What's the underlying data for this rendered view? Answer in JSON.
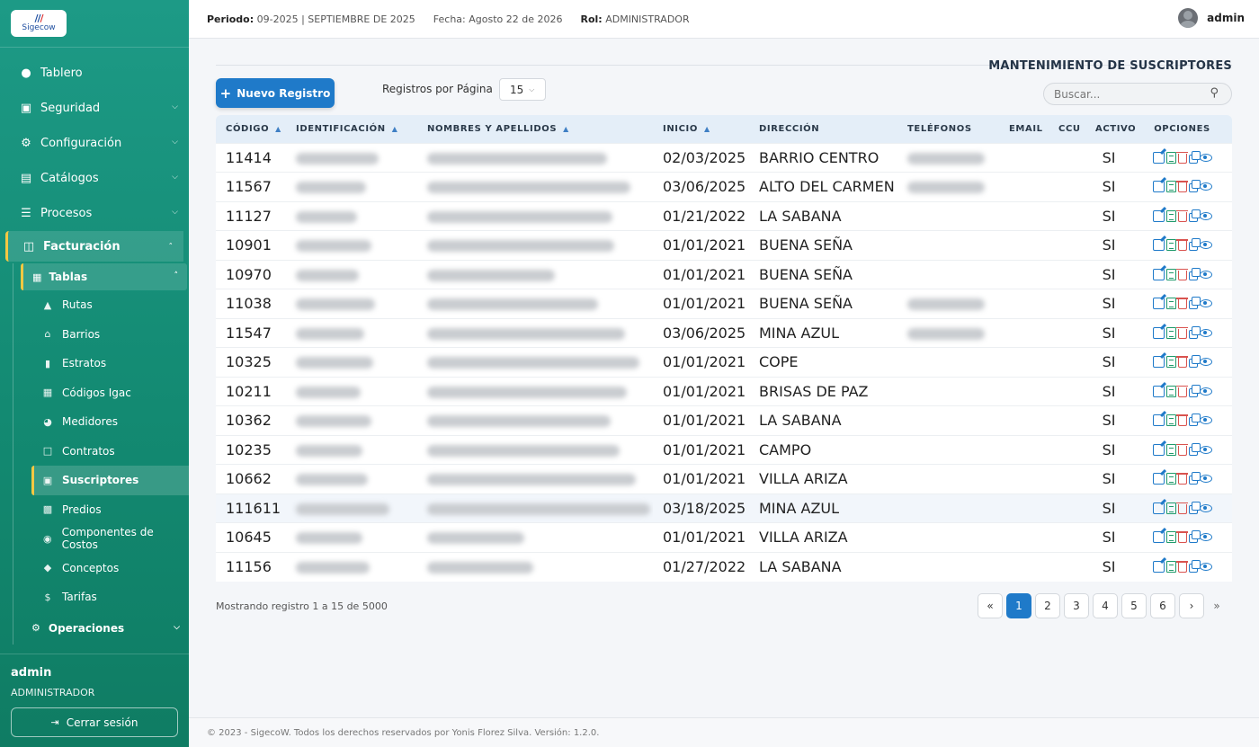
{
  "brand": {
    "logo_text": "Sigecow"
  },
  "sidebar": {
    "items": [
      {
        "label": "Tablero",
        "icon": "droplet-icon"
      },
      {
        "label": "Seguridad",
        "icon": "lock-icon"
      },
      {
        "label": "Configuración",
        "icon": "gears-icon"
      },
      {
        "label": "Catálogos",
        "icon": "book-icon"
      },
      {
        "label": "Procesos",
        "icon": "list-icon"
      },
      {
        "label": "Facturación",
        "icon": "invoice-icon"
      }
    ],
    "submenu_label": "Tablas",
    "subitems": [
      {
        "label": "Rutas",
        "icon": "road-icon"
      },
      {
        "label": "Barrios",
        "icon": "home-icon"
      },
      {
        "label": "Estratos",
        "icon": "signal-icon"
      },
      {
        "label": "Códigos Igac",
        "icon": "table-icon"
      },
      {
        "label": "Medidores",
        "icon": "gauge-icon"
      },
      {
        "label": "Contratos",
        "icon": "file-icon"
      },
      {
        "label": "Suscriptores",
        "icon": "user-card-icon"
      },
      {
        "label": "Predios",
        "icon": "building-icon"
      },
      {
        "label": "Componentes de Costos",
        "icon": "coins-icon"
      },
      {
        "label": "Conceptos",
        "icon": "tag-icon"
      },
      {
        "label": "Tarifas",
        "icon": "dollar-icon"
      }
    ],
    "ops_label": "Operaciones",
    "user_name": "admin",
    "user_role": "ADMINISTRADOR",
    "logout_label": "Cerrar sesión"
  },
  "topbar": {
    "periodo_label": "Periodo:",
    "periodo_value": "09-2025 | SEPTIEMBRE DE 2025",
    "fecha": "Fecha: Agosto 22 de 2026",
    "rol_label": "Rol:",
    "rol_value": "ADMINISTRADOR",
    "user": "admin"
  },
  "page": {
    "title": "MANTENIMIENTO DE SUSCRIPTORES",
    "new_button": "Nuevo Registro",
    "per_page_label": "Registros por Página",
    "per_page_value": "15",
    "search_placeholder": "Buscar..."
  },
  "table": {
    "headers": [
      "CÓDIGO",
      "IDENTIFICACIÓN",
      "NOMBRES Y APELLIDOS",
      "INICIO",
      "DIRECCIÓN",
      "TELÉFONOS",
      "EMAIL",
      "CCU",
      "ACTIVO",
      "OPCIONES"
    ],
    "rows": [
      {
        "codigo": "11414",
        "inicio": "02/03/2025",
        "direccion": "BARRIO CENTRO",
        "activo": "SI",
        "has_phone": true
      },
      {
        "codigo": "11567",
        "inicio": "03/06/2025",
        "direccion": "ALTO DEL CARMEN",
        "activo": "SI",
        "has_phone": true
      },
      {
        "codigo": "11127",
        "inicio": "01/21/2022",
        "direccion": "LA SABANA",
        "activo": "SI",
        "has_phone": false
      },
      {
        "codigo": "10901",
        "inicio": "01/01/2021",
        "direccion": "BUENA SEÑA",
        "activo": "SI",
        "has_phone": false
      },
      {
        "codigo": "10970",
        "inicio": "01/01/2021",
        "direccion": "BUENA SEÑA",
        "activo": "SI",
        "has_phone": false
      },
      {
        "codigo": "11038",
        "inicio": "01/01/2021",
        "direccion": "BUENA SEÑA",
        "activo": "SI",
        "has_phone": true
      },
      {
        "codigo": "11547",
        "inicio": "03/06/2025",
        "direccion": "MINA AZUL",
        "activo": "SI",
        "has_phone": true
      },
      {
        "codigo": "10325",
        "inicio": "01/01/2021",
        "direccion": "COPE",
        "activo": "SI",
        "has_phone": false
      },
      {
        "codigo": "10211",
        "inicio": "01/01/2021",
        "direccion": "BRISAS DE PAZ",
        "activo": "SI",
        "has_phone": false
      },
      {
        "codigo": "10362",
        "inicio": "01/01/2021",
        "direccion": "LA SABANA",
        "activo": "SI",
        "has_phone": false
      },
      {
        "codigo": "10235",
        "inicio": "01/01/2021",
        "direccion": "CAMPO",
        "activo": "SI",
        "has_phone": false
      },
      {
        "codigo": "10662",
        "inicio": "01/01/2021",
        "direccion": "VILLA ARIZA",
        "activo": "SI",
        "has_phone": false
      },
      {
        "codigo": "111611",
        "inicio": "03/18/2025",
        "direccion": "MINA AZUL",
        "activo": "SI",
        "has_phone": false
      },
      {
        "codigo": "10645",
        "inicio": "01/01/2021",
        "direccion": "VILLA ARIZA",
        "activo": "SI",
        "has_phone": false
      },
      {
        "codigo": "11156",
        "inicio": "01/27/2022",
        "direccion": "LA SABANA",
        "activo": "SI",
        "has_phone": false
      }
    ]
  },
  "pagination": {
    "showing": "Mostrando registro 1 a 15 de 5000",
    "first": "«",
    "pages": [
      "1",
      "2",
      "3",
      "4",
      "5",
      "6"
    ],
    "active_page": "1",
    "next": "›",
    "last": "»"
  },
  "footer": {
    "text": "© 2023 - SigecoW. Todos los derechos reservados por Yonis Florez Silva. Versión: 1.2.0."
  },
  "colors": {
    "sidebar": "#138a72",
    "accent": "#1f7ac9",
    "active_marker": "#f5c842"
  }
}
